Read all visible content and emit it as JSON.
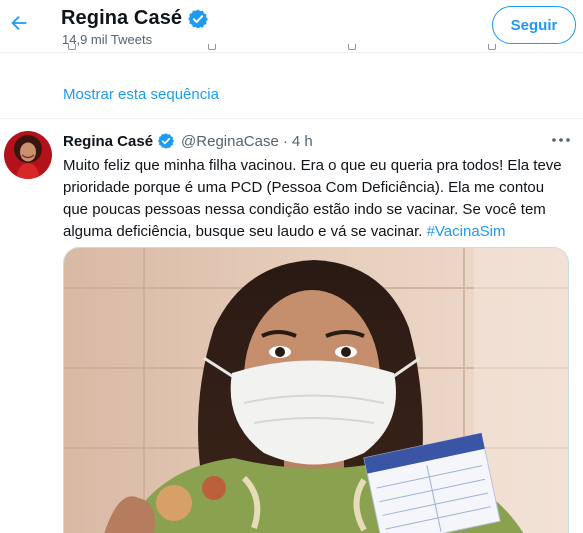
{
  "header": {
    "name": "Regina Casé",
    "tweet_count": "14,9 mil Tweets",
    "follow_label": "Seguir"
  },
  "thread": {
    "show_thread_label": "Mostrar esta sequência"
  },
  "tweet": {
    "author_name": "Regina Casé",
    "handle": "@ReginaCase",
    "separator": "·",
    "time": "4 h",
    "text": "Muito feliz que minha filha vacinou. Era o que eu queria pra todos! Ela teve prioridade porque é uma PCD (Pessoa Com Deficiência). Ela me contou que poucas pessoas nessa condição estão indo se vacinar. Se você tem alguma deficiência, busque seu laudo e vá se vacinar. ",
    "hashtag": "#VacinaSim"
  },
  "icons": {
    "back": "arrow-left-icon",
    "verified": "verified-badge-icon",
    "more": "more-horizontal-icon"
  },
  "colors": {
    "accent": "#1d9bf0",
    "text_primary": "#0f1419",
    "text_secondary": "#536471",
    "border": "#eff3f4"
  }
}
